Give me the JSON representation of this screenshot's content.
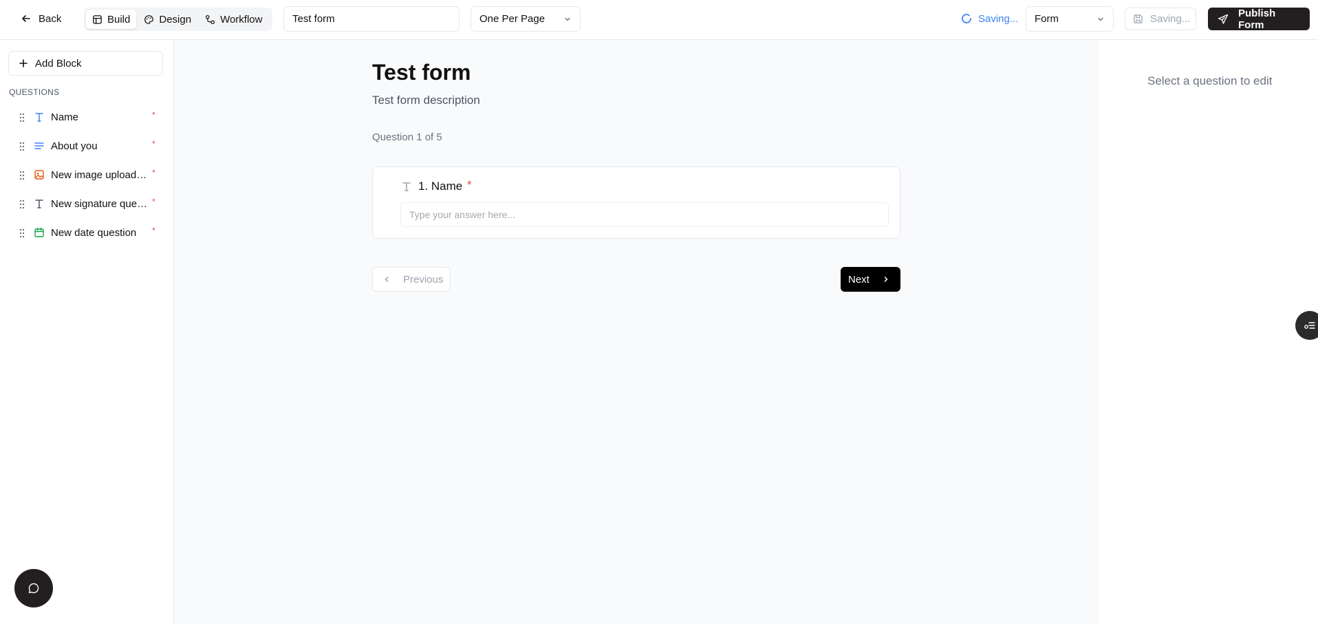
{
  "topbar": {
    "back_label": "Back",
    "mode_tabs": [
      {
        "label": "Build",
        "icon": "layout-icon",
        "active": true
      },
      {
        "label": "Design",
        "icon": "palette-icon",
        "active": false
      },
      {
        "label": "Workflow",
        "icon": "workflow-icon",
        "active": false
      }
    ],
    "form_title_value": "Test form",
    "layout_select_value": "One Per Page",
    "saving_status": "Saving...",
    "view_select_value": "Form",
    "save_button_label": "Saving...",
    "publish_label": "Publish Form",
    "colors": {
      "accent": "#3b82f6",
      "dark": "#231f20"
    }
  },
  "sidebar": {
    "add_block_label": "Add Block",
    "questions_heading": "QUESTIONS",
    "questions": [
      {
        "label": "Name",
        "icon": "text-type-icon",
        "icon_color": "#3b82f6",
        "required_mark": "*"
      },
      {
        "label": "About you",
        "icon": "paragraph-icon",
        "icon_color": "#3b82f6",
        "required_mark": "*"
      },
      {
        "label": "New image upload q...",
        "icon": "image-icon",
        "icon_color": "#ea580c",
        "required_mark": "*"
      },
      {
        "label": "New signature ques...",
        "icon": "text-type-icon",
        "icon_color": "#4b5563",
        "required_mark": "*"
      },
      {
        "label": "New date question",
        "icon": "calendar-icon",
        "icon_color": "#16a34a",
        "required_mark": "*"
      }
    ]
  },
  "canvas": {
    "form_title": "Test form",
    "form_description": "Test form description",
    "progress_text": "Question 1 of 5",
    "question": {
      "title": "1. Name",
      "required_mark": "*",
      "placeholder": "Type your answer here..."
    },
    "previous_label": "Previous",
    "next_label": "Next"
  },
  "right_panel": {
    "hint": "Select a question to edit"
  }
}
